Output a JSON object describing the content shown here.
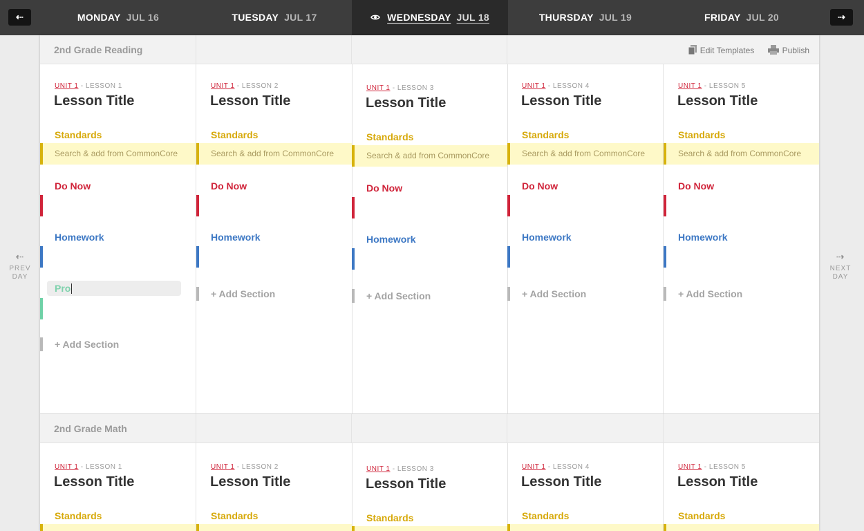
{
  "nav": {
    "prev_button_icon": "double-arrow-left-icon",
    "next_button_icon": "double-arrow-right-icon",
    "prev_label": "PREV\nDAY",
    "next_label": "NEXT\nDAY",
    "prev_day_top": "PREV",
    "prev_day_bottom": "DAY",
    "next_day_top": "NEXT",
    "next_day_bottom": "DAY"
  },
  "days": [
    {
      "weekday": "MONDAY",
      "date": "JUL 16"
    },
    {
      "weekday": "TUESDAY",
      "date": "JUL 17"
    },
    {
      "weekday": "WEDNESDAY",
      "date": "JUL 18",
      "active": true
    },
    {
      "weekday": "THURSDAY",
      "date": "JUL 19"
    },
    {
      "weekday": "FRIDAY",
      "date": "JUL 20"
    }
  ],
  "toolbar": {
    "edit_templates": "Edit Templates",
    "publish": "Publish"
  },
  "classes": [
    {
      "name": "2nd Grade Reading",
      "lessons": [
        {
          "unit": "UNIT 1",
          "lesson": "- LESSON 1",
          "title": "Lesson Title"
        },
        {
          "unit": "UNIT 1",
          "lesson": "- LESSON 2",
          "title": "Lesson Title"
        },
        {
          "unit": "UNIT 1",
          "lesson": "- LESSON 3",
          "title": "Lesson Title"
        },
        {
          "unit": "UNIT 1",
          "lesson": "- LESSON 4",
          "title": "Lesson Title"
        },
        {
          "unit": "UNIT 1",
          "lesson": "- LESSON 5",
          "title": "Lesson Title"
        }
      ],
      "sections": {
        "standards": "Standards",
        "standards_placeholder": "Search & add from CommonCore",
        "do_now": "Do Now",
        "homework": "Homework",
        "add_section": "+ Add Section",
        "new_section_input_value": "Pro"
      }
    },
    {
      "name": "2nd Grade Math",
      "lessons": [
        {
          "unit": "UNIT 1",
          "lesson": "- LESSON 1",
          "title": "Lesson Title"
        },
        {
          "unit": "UNIT 1",
          "lesson": "- LESSON 2",
          "title": "Lesson Title"
        },
        {
          "unit": "UNIT 1",
          "lesson": "- LESSON 3",
          "title": "Lesson Title"
        },
        {
          "unit": "UNIT 1",
          "lesson": "- LESSON 4",
          "title": "Lesson Title"
        },
        {
          "unit": "UNIT 1",
          "lesson": "- LESSON 5",
          "title": "Lesson Title"
        }
      ],
      "sections": {
        "standards": "Standards"
      }
    }
  ],
  "colors": {
    "header_bg": "#3d3d3d",
    "active_day_bg": "#2a2a2a",
    "unit_red": "#d0243a",
    "standards_gold": "#d7a90a",
    "standards_bg": "#fef9c8",
    "homework_blue": "#3d78c4",
    "new_section_green": "#6fd1a7"
  }
}
